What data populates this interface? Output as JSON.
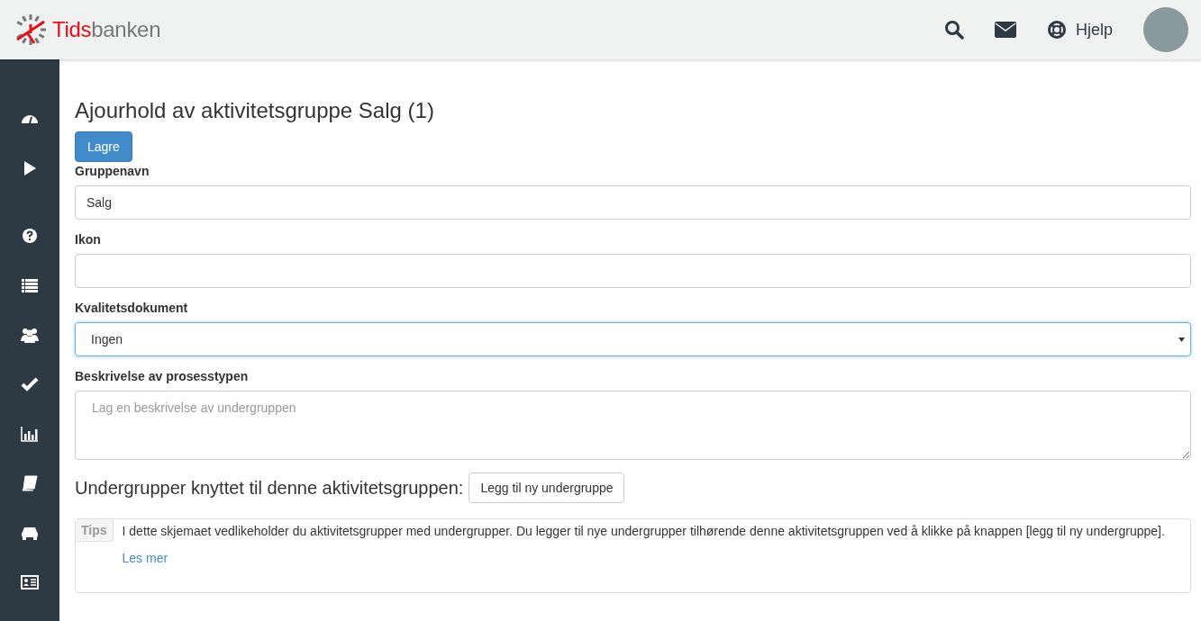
{
  "header": {
    "brand": {
      "part_1": "Tids",
      "part_2": "banken"
    },
    "help_label": "Hjelp"
  },
  "page": {
    "title": "Ajourhold av aktivitetsgruppe Salg (1)",
    "save_button": "Lagre"
  },
  "form": {
    "fields": [
      {
        "kind": "text",
        "label": "Gruppenavn",
        "value": "Salg",
        "focused": false
      },
      {
        "kind": "text",
        "label": "Ikon",
        "focused": false
      },
      {
        "kind": "select",
        "label": "Kvalitetsdokument",
        "value": "Ingen",
        "focused": true
      },
      {
        "kind": "textarea",
        "label": "Beskrivelse av prosesstypen",
        "placeholder": "Lag en beskrivelse av undergruppen",
        "focused": false
      }
    ]
  },
  "subgroups": {
    "heading": "Undergrupper knyttet til denne aktivitetsgruppen:",
    "add_button": "Legg til ny undergruppe"
  },
  "tips": {
    "tag": "Tips",
    "text": "I dette skjemaet vedlikeholder du aktivitetsgrupper med undergrupper. Du legger til nye undergrupper tilhørende denne aktivitetsgruppen ved å klikke på knappen [legg til ny undergruppe].",
    "link": "Les mer"
  }
}
